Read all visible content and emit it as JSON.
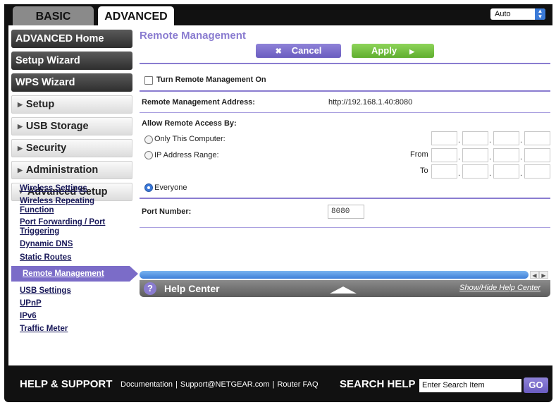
{
  "tabs": {
    "basic": "BASIC",
    "advanced": "ADVANCED"
  },
  "language_select": {
    "value": "Auto"
  },
  "sidebar": {
    "main_items": [
      {
        "label": "ADVANCED Home"
      },
      {
        "label": "Setup Wizard"
      },
      {
        "label": "WPS Wizard"
      }
    ],
    "sections": [
      {
        "label": "Setup",
        "expanded": false
      },
      {
        "label": "USB Storage",
        "expanded": false
      },
      {
        "label": "Security",
        "expanded": false
      },
      {
        "label": "Administration",
        "expanded": false
      },
      {
        "label": "Advanced Setup",
        "expanded": true
      }
    ],
    "sub_items": [
      {
        "label": "Wireless Settings"
      },
      {
        "label": "Wireless Repeating Function"
      },
      {
        "label": "Port Forwarding / Port Triggering"
      },
      {
        "label": "Dynamic DNS"
      },
      {
        "label": "Static Routes"
      },
      {
        "label": "Remote Management",
        "active": true
      },
      {
        "label": "USB Settings"
      },
      {
        "label": "UPnP"
      },
      {
        "label": "IPv6"
      },
      {
        "label": "Traffic Meter"
      }
    ]
  },
  "main": {
    "title": "Remote Management",
    "cancel_label": "Cancel",
    "apply_label": "Apply",
    "remote_toggle_label": "Turn Remote Management On",
    "remote_toggle_checked": false,
    "address_label": "Remote Management Address:",
    "address_value": "http://192.168.1.40:8080",
    "access_label": "Allow Remote Access By:",
    "option_only_this": "Only This Computer:",
    "option_ip_range": "IP Address Range:",
    "from_label": "From",
    "to_label": "To",
    "option_everyone": "Everyone",
    "selected_option": "Everyone",
    "port_label": "Port Number:",
    "port_value": "8080"
  },
  "help_center": {
    "icon_text": "?",
    "title": "Help Center",
    "toggle_label": "Show/Hide Help Center"
  },
  "footer": {
    "title": "HELP & SUPPORT",
    "links": [
      "Documentation",
      "Support@NETGEAR.com",
      "Router FAQ"
    ],
    "search_label": "SEARCH HELP",
    "search_placeholder": "Enter Search Item",
    "go_label": "GO"
  },
  "colors": {
    "accent_purple": "#8a7cd0",
    "apply_green": "#6dbb3c",
    "scroll_blue": "#3f7fd8"
  }
}
